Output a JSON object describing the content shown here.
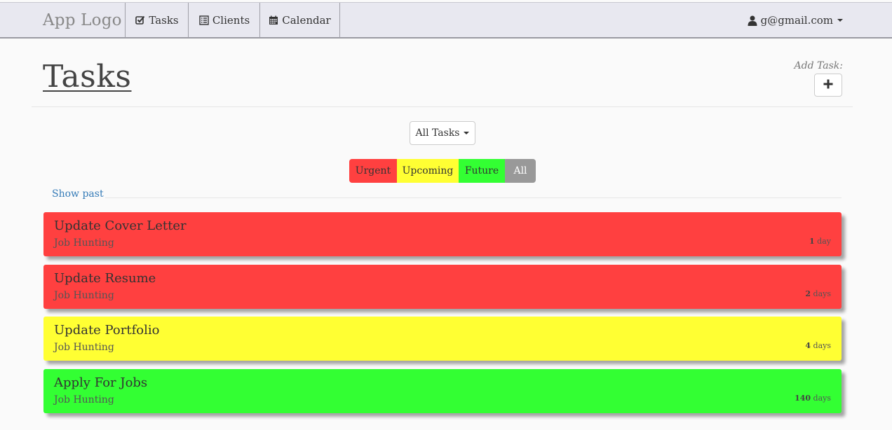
{
  "navbar": {
    "brand": "App Logo",
    "items": [
      {
        "label": "Tasks",
        "icon": "check-square-icon"
      },
      {
        "label": "Clients",
        "icon": "list-icon"
      },
      {
        "label": "Calendar",
        "icon": "calendar-icon"
      }
    ],
    "user": {
      "label": "g@gmail.com",
      "icon": "user-icon"
    }
  },
  "header": {
    "title": "Tasks",
    "add_label": "Add Task:",
    "add_button": "+"
  },
  "filter": {
    "selected": "All Tasks"
  },
  "urgency": {
    "buttons": [
      {
        "label": "Urgent",
        "color": "#ff4040"
      },
      {
        "label": "Upcoming",
        "color": "#ffff33"
      },
      {
        "label": "Future",
        "color": "#33ff33"
      },
      {
        "label": "All",
        "color": "#999999"
      }
    ]
  },
  "show_past": "Show past",
  "tasks": [
    {
      "title": "Update Cover Letter",
      "category": "Job Hunting",
      "due_num": "1",
      "due_unit": "day",
      "color": "#ff4040"
    },
    {
      "title": "Update Resume",
      "category": "Job Hunting",
      "due_num": "2",
      "due_unit": "days",
      "color": "#ff4040"
    },
    {
      "title": "Update Portfolio",
      "category": "Job Hunting",
      "due_num": "4",
      "due_unit": "days",
      "color": "#ffff33"
    },
    {
      "title": "Apply For Jobs",
      "category": "Job Hunting",
      "due_num": "140",
      "due_unit": "days",
      "color": "#33ff33"
    }
  ]
}
